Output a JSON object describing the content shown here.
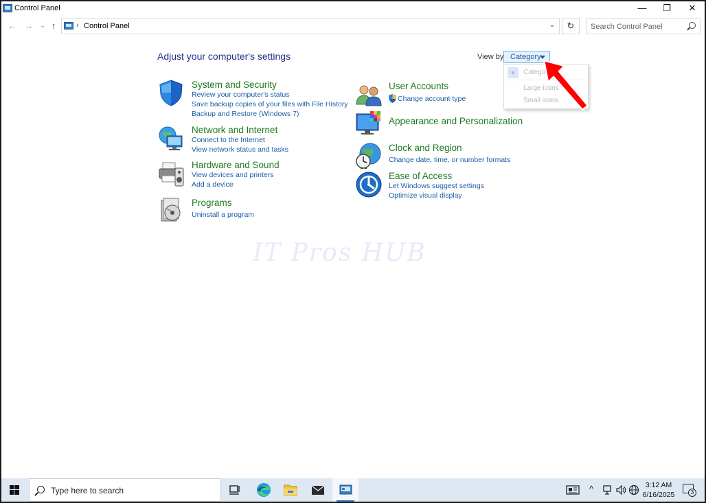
{
  "window": {
    "title": "Control Panel",
    "minimize_glyph": "—",
    "restore_glyph": "❐",
    "close_glyph": "✕"
  },
  "nav": {
    "back_glyph": "←",
    "forward_glyph": "→",
    "recent_glyph": "⌄",
    "up_glyph": "↑",
    "breadcrumb_separator": "›",
    "address_path": "Control Panel",
    "dropdown_glyph": "⌄",
    "refresh_glyph": "↻",
    "search_placeholder": "Search Control Panel"
  },
  "main": {
    "heading": "Adjust your computer's settings",
    "view_by_label": "View by:",
    "view_by_value": "Category",
    "view_options": [
      "Category",
      "Large icons",
      "Small icons"
    ],
    "categories_left": [
      {
        "title": "System and Security",
        "icon": "shield-icon",
        "links": [
          "Review your computer's status",
          "Save backup copies of your files with File History",
          "Backup and Restore (Windows 7)"
        ]
      },
      {
        "title": "Network and Internet",
        "icon": "globe-network-icon",
        "links": [
          "Connect to the Internet",
          "View network status and tasks"
        ]
      },
      {
        "title": "Hardware and Sound",
        "icon": "printer-speaker-icon",
        "links": [
          "View devices and printers",
          "Add a device"
        ]
      },
      {
        "title": "Programs",
        "icon": "programs-disc-icon",
        "links": [
          "Uninstall a program"
        ]
      }
    ],
    "categories_right": [
      {
        "title": "User Accounts",
        "icon": "users-icon",
        "links": [
          "Change account type"
        ]
      },
      {
        "title": "Appearance and Personalization",
        "icon": "monitor-palette-icon",
        "links": []
      },
      {
        "title": "Clock and Region",
        "icon": "clock-globe-icon",
        "links": [
          "Change date, time, or number formats"
        ]
      },
      {
        "title": "Ease of Access",
        "icon": "ease-of-access-icon",
        "links": [
          "Let Windows suggest settings",
          "Optimize visual display"
        ]
      }
    ],
    "watermark": "IT Pros HUB",
    "annotation": "red-arrow-icon"
  },
  "taskbar": {
    "search_placeholder": "Type here to search",
    "apps": [
      "task-view-icon",
      "edge-icon",
      "file-explorer-icon",
      "mail-icon",
      "control-panel-icon"
    ],
    "tray": {
      "chevron_glyph": "^",
      "time": "3:12 AM",
      "date": "6/16/2025",
      "notification_count": "3"
    }
  },
  "colors": {
    "category_title": "#1f7a1f",
    "link": "#1a5ea8",
    "heading": "#1e3287",
    "annotation_arrow": "#ff0000",
    "taskbar": "#dde8f3"
  }
}
